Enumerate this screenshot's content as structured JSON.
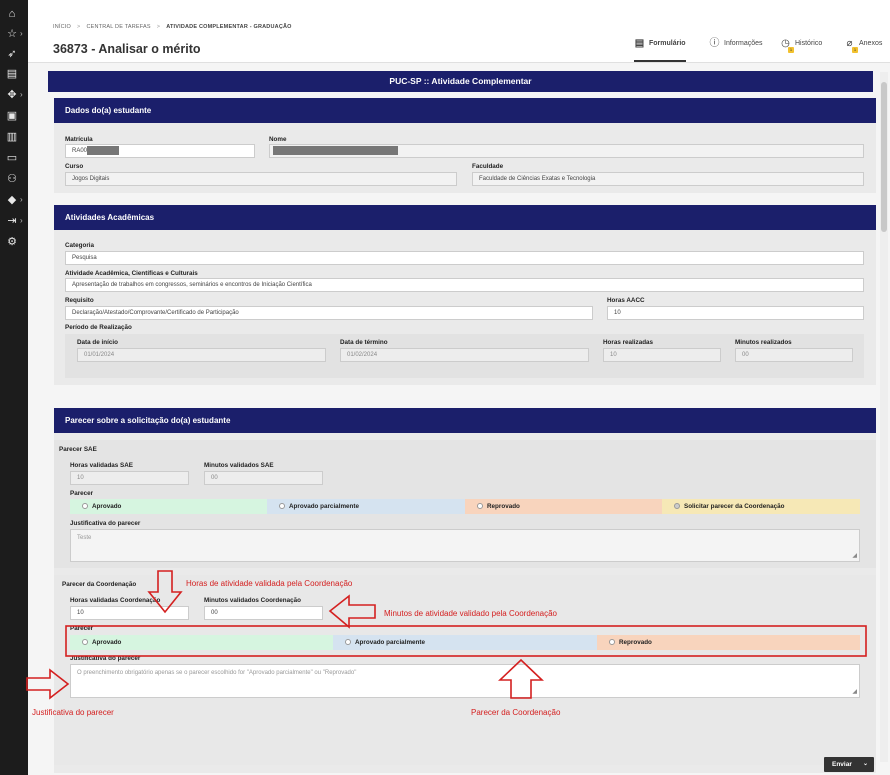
{
  "sidebar": {
    "items": [
      {
        "icon": "home-icon",
        "glyph": "⌂",
        "chevron": false
      },
      {
        "icon": "star-icon",
        "glyph": "☆",
        "chevron": true
      },
      {
        "icon": "rocket-icon",
        "glyph": "➶",
        "chevron": false
      },
      {
        "icon": "documents-icon",
        "glyph": "▤",
        "chevron": false
      },
      {
        "icon": "move-icon",
        "glyph": "✥",
        "chevron": true
      },
      {
        "icon": "inbox-icon",
        "glyph": "▣",
        "chevron": false
      },
      {
        "icon": "trash-icon",
        "glyph": "▥",
        "chevron": false
      },
      {
        "icon": "chat-icon",
        "glyph": "▭",
        "chevron": false
      },
      {
        "icon": "users-icon",
        "glyph": "⚇",
        "chevron": false
      },
      {
        "icon": "graduation-icon",
        "glyph": "◆",
        "chevron": true
      },
      {
        "icon": "exit-icon",
        "glyph": "⇥",
        "chevron": true
      },
      {
        "icon": "settings-icon",
        "glyph": "⚙",
        "chevron": false
      }
    ]
  },
  "breadcrumb": {
    "home": "INÍCIO",
    "tasks": "CENTRAL DE TAREFAS",
    "current": "ATIVIDADE COMPLEMENTAR - GRADUAÇÃO"
  },
  "page_title": "36873 - Analisar o mérito",
  "tabs": [
    {
      "label": "Formulário",
      "icon": "form-icon",
      "glyph": "▤",
      "badge": ""
    },
    {
      "label": "Informações",
      "icon": "info-icon",
      "glyph": "ⓘ",
      "badge": ""
    },
    {
      "label": "Histórico",
      "icon": "clock-icon",
      "glyph": "◷",
      "badge": "1"
    },
    {
      "label": "Anexos",
      "icon": "attachment-icon",
      "glyph": "⌀",
      "badge": "1"
    }
  ],
  "form_header": "PUC-SP :: Atividade Complementar",
  "student": {
    "title": "Dados do(a) estudante",
    "matricula_label": "Matrícula",
    "matricula_value": "RA00",
    "nome_label": "Nome",
    "curso_label": "Curso",
    "curso_value": "Jogos Digitais",
    "faculdade_label": "Faculdade",
    "faculdade_value": "Faculdade de Ciências Exatas e Tecnologia"
  },
  "activities": {
    "title": "Atividades Acadêmicas",
    "categoria_label": "Categoria",
    "categoria_value": "Pesquisa",
    "atividade_label": "Atividade Acadêmica, Científicas e Culturais",
    "atividade_value": "Apresentação de trabalhos em congressos, seminários e encontros de Iniciação Científica",
    "requisito_label": "Requisito",
    "requisito_value": "Declaração/Atestado/Comprovante/Certificado de Participação",
    "horas_aacc_label": "Horas AACC",
    "horas_aacc_value": "10",
    "periodo_label": "Período de Realização",
    "inicio_label": "Data de início",
    "inicio_value": "01/01/2024",
    "termino_label": "Data de término",
    "termino_value": "01/02/2024",
    "horas_real_label": "Horas realizadas",
    "horas_real_value": "10",
    "min_real_label": "Minutos realizados",
    "min_real_value": "00"
  },
  "opinion": {
    "title": "Parecer sobre a solicitação do(a) estudante",
    "sae": {
      "title": "Parecer SAE",
      "horas_label": "Horas validadas SAE",
      "horas_value": "10",
      "min_label": "Minutos validados SAE",
      "min_value": "00",
      "parecer_label": "Parecer",
      "options": [
        "Aprovado",
        "Aprovado parcialmente",
        "Reprovado",
        "Solicitar parecer da Coordenação"
      ],
      "justif_label": "Justificativa do parecer",
      "justif_value": "Teste"
    },
    "coord": {
      "title": "Parecer da Coordenação",
      "horas_label": "Horas validadas Coordenação",
      "horas_value": "10",
      "min_label": "Minutos validados Coordenação",
      "min_value": "00",
      "parecer_label": "Parecer",
      "options": [
        "Aprovado",
        "Aprovado parcialmente",
        "Reprovado"
      ],
      "justif_label": "Justificativa do parecer",
      "justif_placeholder": "O preenchimento obrigatório apenas se o parecer escolhido for \"Aprovado parcialmente\" ou \"Reprovado\""
    }
  },
  "annotations": {
    "horas": "Horas de atividade validada pela Coordenação",
    "minutos": "Minutos de atividade validado pela Coordenação",
    "justificativa": "Justificativa do parecer",
    "parecer": "Parecer da Coordenação"
  },
  "send_button": "Enviar",
  "colors": {
    "navy": "#1b1f6b",
    "annotation_red": "#d42020",
    "approved": "#d6f5e0",
    "partial": "#d5e3f0",
    "rejected": "#f8d4bd",
    "coordination": "#f6e8b6"
  }
}
